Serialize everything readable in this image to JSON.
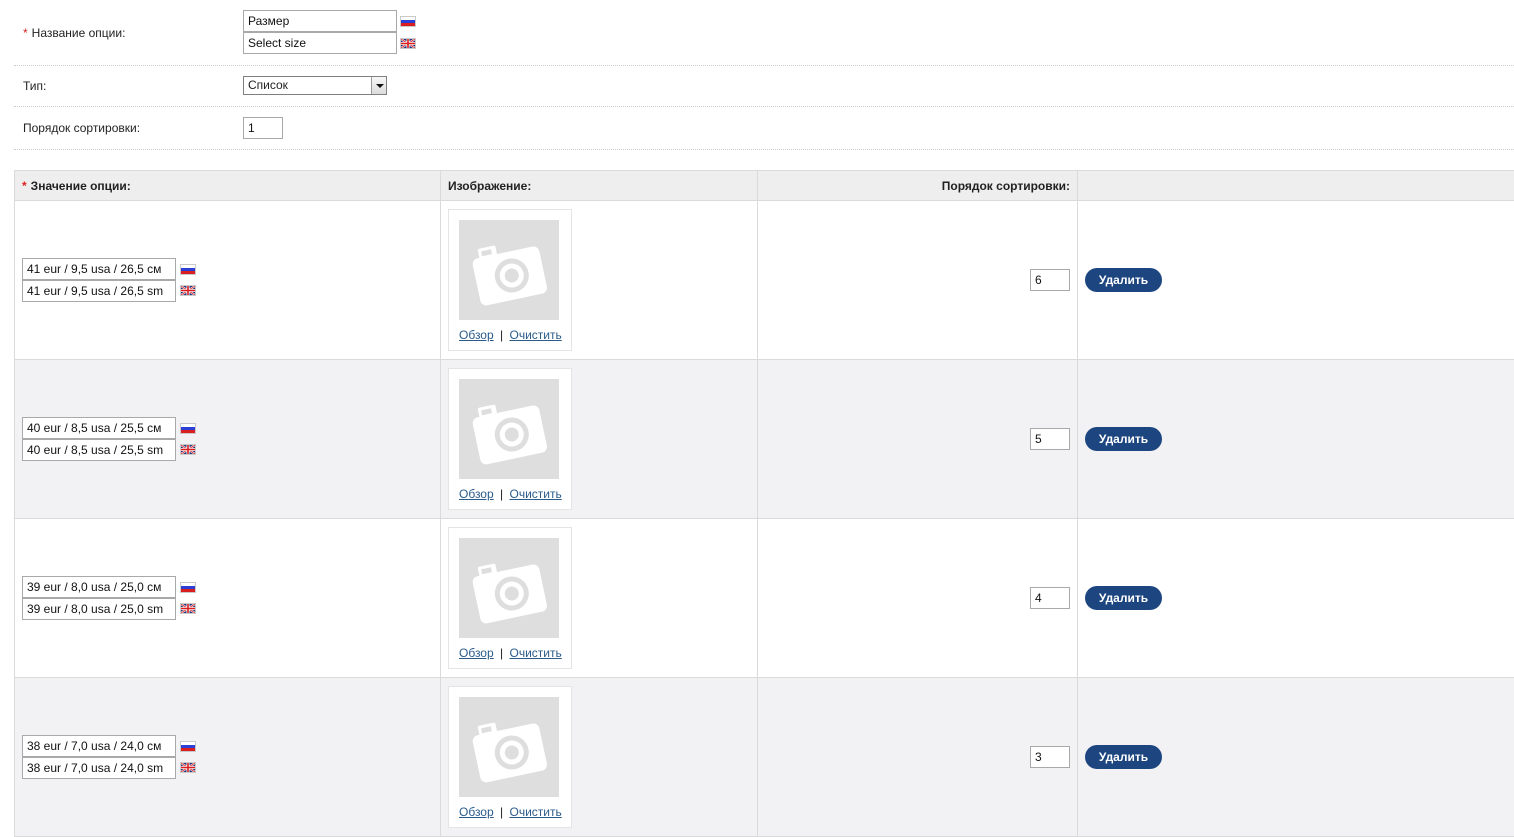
{
  "form": {
    "option_name": {
      "required_mark": "*",
      "label": "Название опции:",
      "value_ru": "Размер",
      "value_en": "Select size"
    },
    "type": {
      "label": "Тип:",
      "selected": "Список"
    },
    "sort_order": {
      "label": "Порядок сортировки:",
      "value": "1"
    }
  },
  "values_table": {
    "headers": {
      "required_mark": "*",
      "value": "Значение опции:",
      "image": "Изображение:",
      "sort": "Порядок сортировки:"
    },
    "image_links": {
      "browse": "Обзор",
      "separator": "|",
      "clear": "Очистить"
    },
    "delete_label": "Удалить",
    "rows": [
      {
        "value_ru": "41 eur / 9,5 usa / 26,5 см",
        "value_en": "41 eur / 9,5 usa / 26,5 sm",
        "sort": "6"
      },
      {
        "value_ru": "40 eur / 8,5 usa / 25,5 см",
        "value_en": "40 eur / 8,5 usa / 25,5 sm",
        "sort": "5"
      },
      {
        "value_ru": "39 eur / 8,0 usa / 25,0 см",
        "value_en": "39 eur / 8,0 usa / 25,0 sm",
        "sort": "4"
      },
      {
        "value_ru": "38 eur / 7,0 usa / 24,0 см",
        "value_en": "38 eur / 7,0 usa / 24,0 sm",
        "sort": "3"
      }
    ]
  },
  "colors": {
    "delete_button": "#1d4580",
    "header_bg": "#eeeeee",
    "alt_row_bg": "#f2f2f5",
    "required": "#e02020",
    "link": "#2a5b8a"
  },
  "icons": {
    "flag_ru": "russian-flag-icon",
    "flag_en": "uk-flag-icon",
    "image_placeholder": "camera-icon",
    "dropdown": "chevron-down-icon"
  }
}
